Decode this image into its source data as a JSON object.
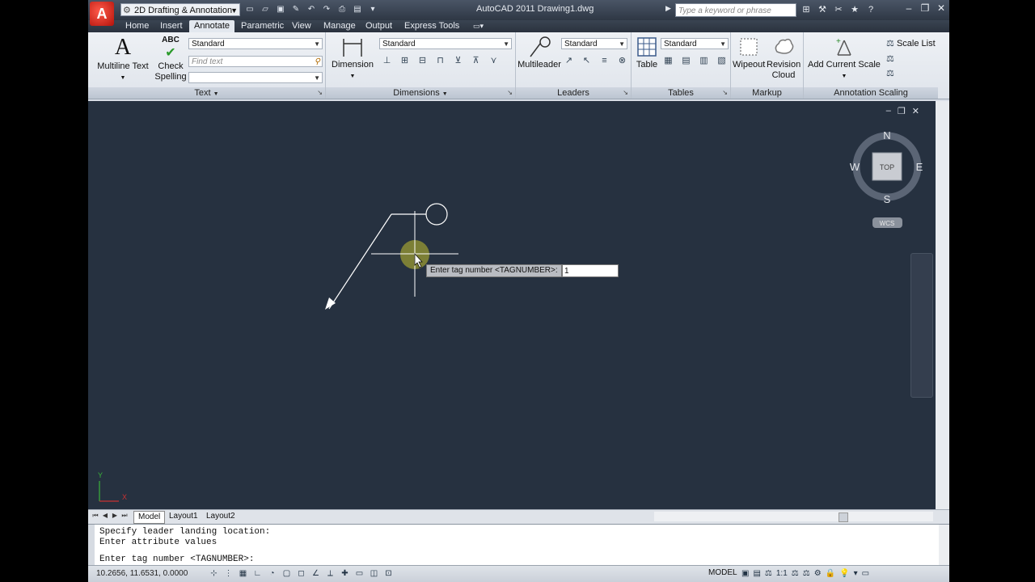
{
  "title": {
    "app_menu_letter": "A",
    "workspace": "2D Drafting & Annotation",
    "window_title": "AutoCAD 2011    Drawing1.dwg",
    "search_placeholder": "Type a keyword or phrase"
  },
  "tabs": [
    {
      "label": "Home"
    },
    {
      "label": "Insert"
    },
    {
      "label": "Annotate",
      "active": true
    },
    {
      "label": "Parametric"
    },
    {
      "label": "View"
    },
    {
      "label": "Manage"
    },
    {
      "label": "Output"
    },
    {
      "label": "Express Tools"
    }
  ],
  "ribbon": {
    "text_panel": {
      "title": "Text",
      "multiline_text": "Multiline Text",
      "multiline_icon_glyph": "A",
      "check_spelling_line1": "Check",
      "check_spelling_line2": "Spelling",
      "spell_icon_glyph": "ABC",
      "style_value": "Standard",
      "find_placeholder": "Find text"
    },
    "dimensions_panel": {
      "title": "Dimensions",
      "dimension_label": "Dimension",
      "style_value": "Standard"
    },
    "leaders_panel": {
      "title": "Leaders",
      "multileader_label": "Multileader",
      "style_value": "Standard"
    },
    "tables_panel": {
      "title": "Tables",
      "table_label": "Table",
      "style_value": "Standard"
    },
    "markup_panel": {
      "title": "Markup",
      "wipeout_label": "Wipeout",
      "revision_line1": "Revision",
      "revision_line2": "Cloud"
    },
    "annotation_scaling_panel": {
      "title": "Annotation Scaling",
      "add_scale_label": "Add Current Scale",
      "scale_list_label": "Scale List"
    }
  },
  "canvas": {
    "prompt_label": "Enter tag number <TAGNUMBER>:",
    "prompt_value": "1",
    "viewcube": {
      "north": "N",
      "south": "S",
      "east": "E",
      "west": "W",
      "face": "TOP",
      "wcs": "WCS"
    },
    "ucs_x": "X",
    "ucs_y": "Y"
  },
  "layout_tabs": [
    {
      "label": "Model",
      "active": true
    },
    {
      "label": "Layout1"
    },
    {
      "label": "Layout2"
    }
  ],
  "command_line": {
    "line1": "Specify leader landing location:",
    "line2": "Enter attribute values",
    "line3": "Enter tag number <TAGNUMBER>:"
  },
  "status": {
    "coordinates": "10.2656, 11.6531, 0.0000",
    "model": "MODEL",
    "scale": "1:1"
  },
  "colors": {
    "canvas_bg": "#263140",
    "app_red": "#c9160d",
    "ribbon_bg": "#e6eaf0"
  }
}
